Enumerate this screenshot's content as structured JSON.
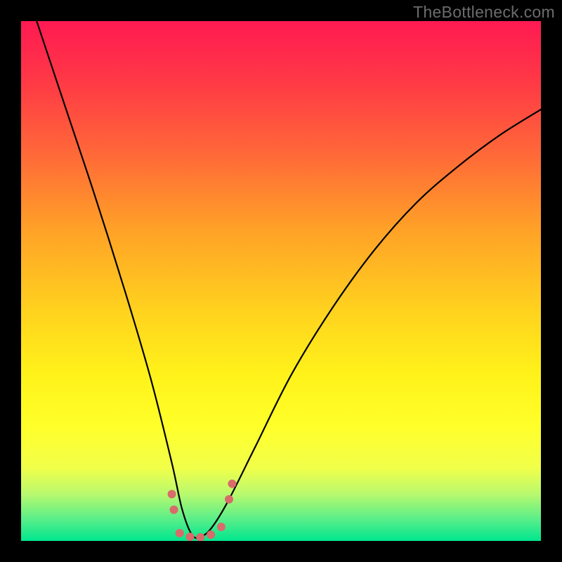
{
  "watermark": "TheBottleneck.com",
  "chart_data": {
    "type": "line",
    "title": "",
    "xlabel": "",
    "ylabel": "",
    "xlim": [
      0,
      100
    ],
    "ylim": [
      0,
      100
    ],
    "grid": false,
    "legend": false,
    "series": [
      {
        "name": "bottleneck-curve",
        "description": "V-shaped curve, minimum near x≈33, value≈0 at the minimum, left branch starts near top-left, right branch rises to upper right",
        "x": [
          3,
          8,
          14,
          20,
          25,
          29,
          31,
          33,
          35,
          37,
          40,
          45,
          52,
          60,
          68,
          76,
          84,
          92,
          100
        ],
        "y": [
          100,
          85,
          67,
          48,
          31,
          15,
          6,
          1,
          1,
          3,
          8,
          18,
          32,
          45,
          56,
          65,
          72,
          78,
          83
        ]
      }
    ],
    "markers": {
      "description": "Coral dots near the trough region highlighting near-zero bottleneck points",
      "color": "#d96b6b",
      "points": [
        {
          "x": 29.0,
          "y": 9.0,
          "r": 6
        },
        {
          "x": 29.4,
          "y": 6.0,
          "r": 6
        },
        {
          "x": 30.5,
          "y": 1.5,
          "r": 6
        },
        {
          "x": 32.5,
          "y": 0.8,
          "r": 6
        },
        {
          "x": 34.5,
          "y": 0.7,
          "r": 6
        },
        {
          "x": 36.5,
          "y": 1.2,
          "r": 6
        },
        {
          "x": 38.5,
          "y": 2.7,
          "r": 6
        },
        {
          "x": 40.0,
          "y": 8.0,
          "r": 6
        },
        {
          "x": 40.6,
          "y": 11.0,
          "r": 6
        }
      ]
    },
    "background_gradient": {
      "top": "#ff1a52",
      "mid": "#fff21a",
      "bottom": "#00e68e"
    }
  }
}
